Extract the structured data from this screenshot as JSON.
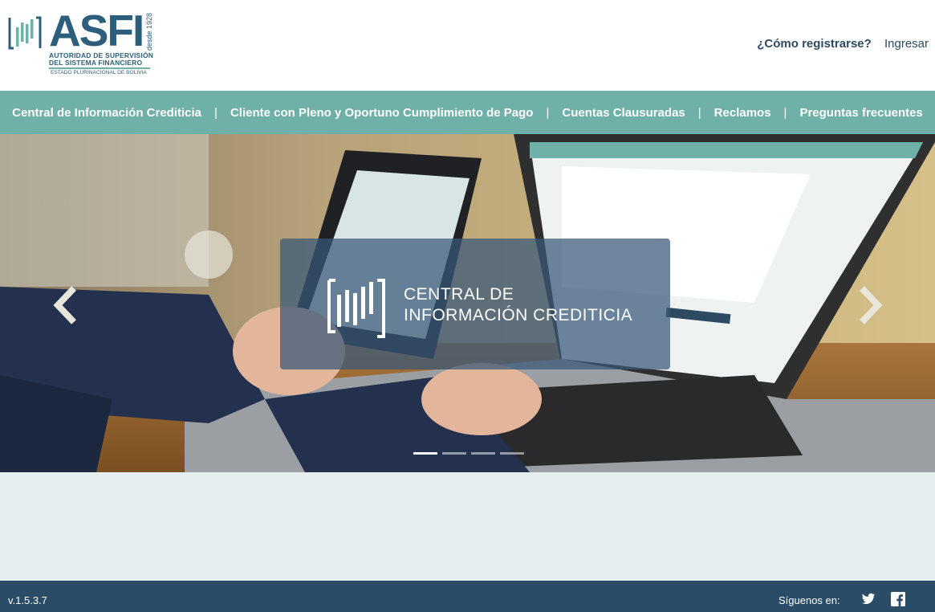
{
  "logo": {
    "name": "ASFI",
    "since": "desde 1928",
    "line1": "AUTORIDAD DE SUPERVISIÓN",
    "line2": "DEL SISTEMA FINANCIERO",
    "line3": "ESTADO PLURINACIONAL DE BOLIVIA"
  },
  "header": {
    "register_label": "¿Cómo registrarse?",
    "login_label": "Ingresar"
  },
  "nav": {
    "items": [
      "Central de Información Crediticia",
      "Cliente con Pleno y Oportuno Cumplimiento de Pago",
      "Cuentas Clausuradas",
      "Reclamos",
      "Preguntas frecuentes"
    ],
    "separator": "|"
  },
  "carousel": {
    "caption_line1": "CENTRAL DE",
    "caption_line2": "INFORMACIÓN CREDITICIA",
    "slide_count": 4,
    "active_index": 0
  },
  "footer": {
    "version": "v.1.5.3.7",
    "follow_label": "Síguenos en:"
  },
  "colors": {
    "brand_dark": "#2d5f7c",
    "nav_teal": "#6fb1a9",
    "footer": "#2b4c66",
    "page_bg": "#e6eef0"
  },
  "icons": [
    "asfi-logo-icon",
    "chevron-left-icon",
    "chevron-right-icon",
    "twitter-icon",
    "facebook-icon"
  ]
}
